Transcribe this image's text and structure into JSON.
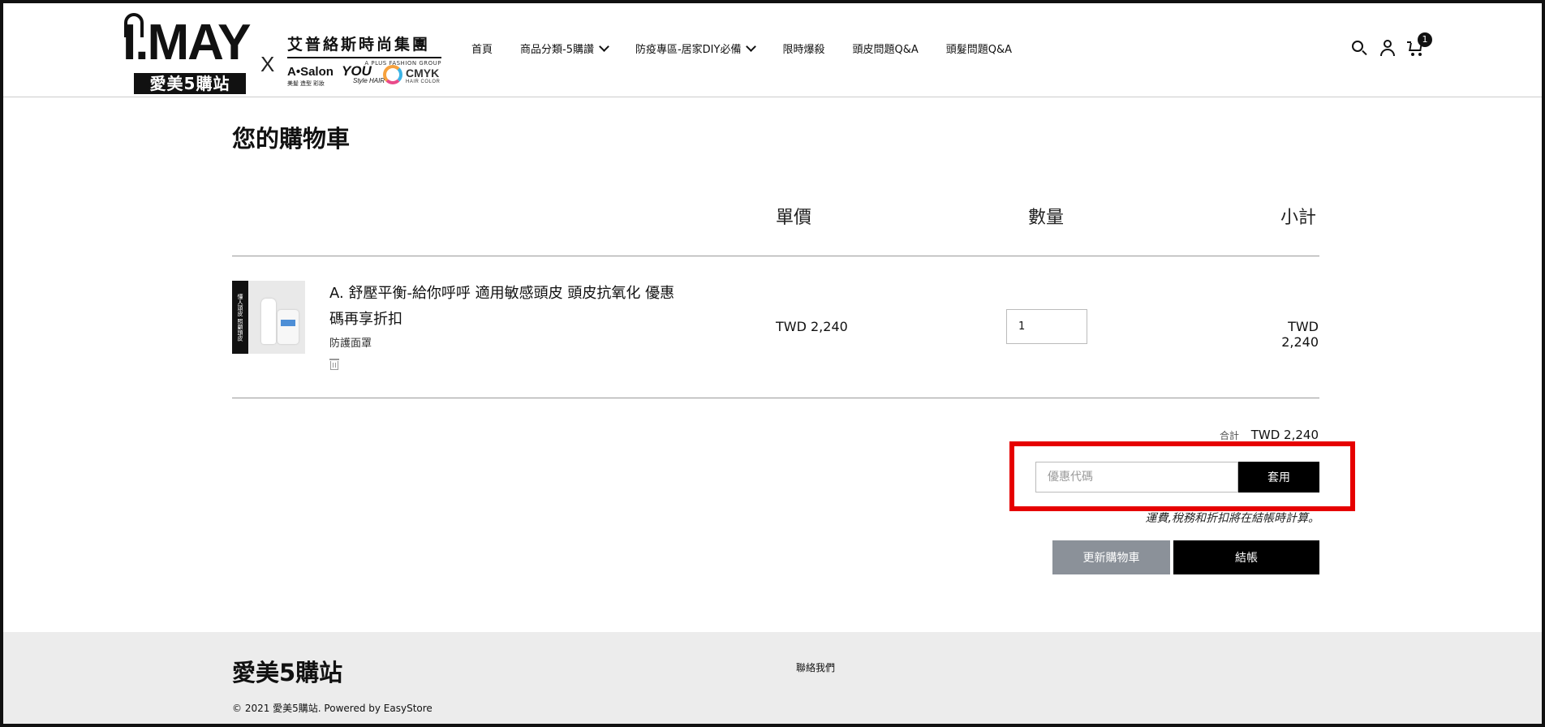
{
  "header": {
    "logo": {
      "main": "I.MAY",
      "sub": "愛美5購站",
      "x": "X",
      "group_cn": "艾普絡斯時尚集團",
      "group_en": "A PLUS FASHION GROUP",
      "brand1": "A•Salon",
      "brand1_sub": "美髮 造型 彩妝",
      "brand2": "YOU",
      "brand2_sub": "Style HAIR",
      "brand3": "CMYK",
      "brand3_sub": "HAIR COLOR"
    },
    "nav": [
      {
        "label": "首頁"
      },
      {
        "label": "商品分類-5購讚"
      },
      {
        "label": "防疫專區-居家DIY必備"
      },
      {
        "label": "限時爆殺"
      },
      {
        "label": "頭皮問題Q&A"
      },
      {
        "label": "頭髮問題Q&A"
      }
    ],
    "icons": {
      "search": "search-icon",
      "account": "user-icon",
      "cart": "cart-icon"
    },
    "cart_count": "1"
  },
  "cart": {
    "title": "您的購物車",
    "columns": {
      "price": "單價",
      "qty": "數量",
      "subtotal": "小計"
    },
    "items": [
      {
        "name": "A. 舒壓平衡-給你呼呼 適用敏感頭皮 頭皮抗氧化 優惠碼再享折扣",
        "variant": "防護面罩",
        "unit_price": "TWD 2,240",
        "qty": "1",
        "subtotal": "TWD 2,240",
        "thumb_text": "懂人頭皮 照顧頭皮"
      }
    ],
    "total_label": "合計",
    "total_value": "TWD 2,240",
    "coupon_placeholder": "優惠代碼",
    "coupon_button": "套用",
    "note": "運費,稅務和折扣將在結帳時計算。",
    "update_button": "更新購物車",
    "checkout_button": "結帳"
  },
  "footer": {
    "brand": "愛美5購站",
    "contact": "聯絡我們",
    "copyright": "© 2021 愛美5購站. Powered by EasyStore"
  },
  "colors": {
    "highlight": "#e60000",
    "primary_button": "#000000",
    "secondary_button": "#8b9199",
    "footer_bg": "#ececec"
  }
}
